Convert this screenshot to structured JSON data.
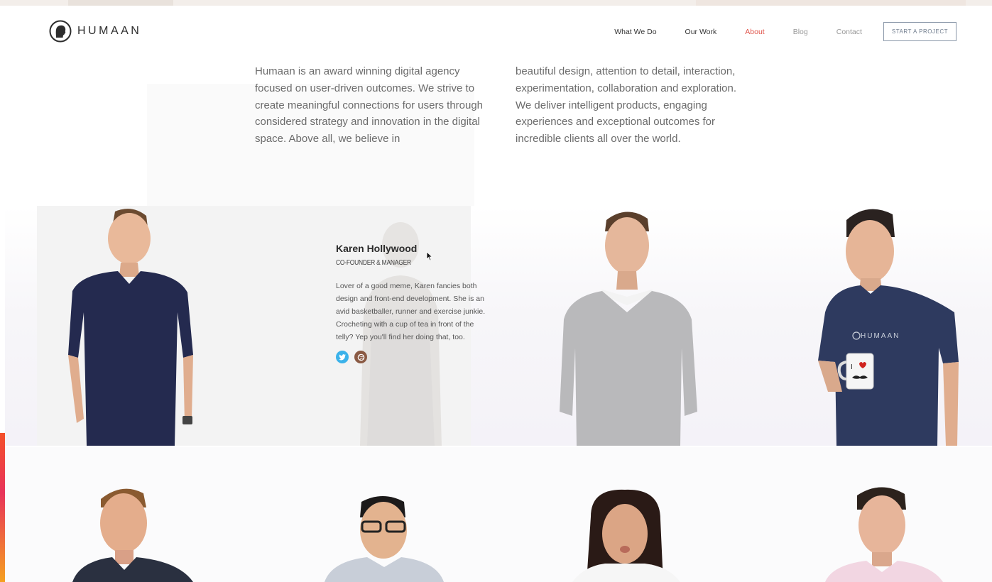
{
  "brand": {
    "name": "HUMAAN"
  },
  "nav": {
    "items": [
      {
        "label": "What We Do",
        "state": "default"
      },
      {
        "label": "Our Work",
        "state": "default"
      },
      {
        "label": "About",
        "state": "active"
      },
      {
        "label": "Blog",
        "state": "muted"
      },
      {
        "label": "Contact",
        "state": "muted"
      }
    ],
    "cta_label": "START A PROJECT"
  },
  "intro": {
    "left": "Humaan is an award winning digital agency focused on user-driven outcomes. We strive to create meaningful connections for users through considered strategy and innovation in the digital space. Above all, we believe in",
    "right": "beautiful design, attention to detail, interaction, experimentation, collaboration and exploration. We deliver intelligent products, engaging experiences and exceptional outcomes for incredible clients all over the world."
  },
  "featured_bio": {
    "name": "Karen Hollywood",
    "role": "CO-FOUNDER & MANAGER",
    "text": "Lover of a good meme, Karen fancies both design and front-end development. She is an avid basketballer, runner and exercise junkie. Crocheting with a cup of tea in front of the telly? Yep you'll find her doing that, too.",
    "social": [
      "twitter-icon",
      "dribbble-icon"
    ]
  },
  "colors": {
    "accent": "#e0574e",
    "text": "#6b6b6b",
    "twitter": "#3bb2ea",
    "cta_border": "#8a97a8"
  }
}
